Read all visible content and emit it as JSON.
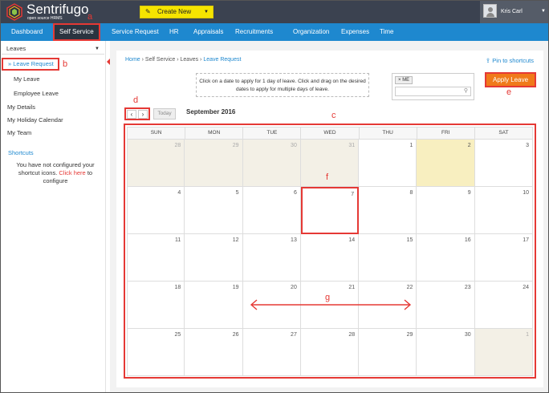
{
  "header": {
    "brand": "Sentrifugo",
    "brand_sub": "open source HRMS",
    "create_label": "Create New",
    "user_name": "Kris Carl"
  },
  "nav": {
    "items": [
      "Dashboard",
      "Self Service",
      "Service Request",
      "HR",
      "Appraisals",
      "Recruitments",
      "Organization",
      "Expenses",
      "Time"
    ]
  },
  "sidebar": {
    "select_value": "Leaves",
    "leave_request": "Leave Request",
    "my_leave": "My Leave",
    "employee_leave": "Employee Leave",
    "my_details": "My Details",
    "holiday_calendar": "My Holiday Calendar",
    "my_team": "My Team",
    "shortcuts": "Shortcuts",
    "note_pre": "You have not configured your shortcut icons.",
    "note_link": "Click here",
    "note_post": "to configure"
  },
  "main": {
    "breadcrumb": [
      "Home",
      "Self Service",
      "Leaves",
      "Leave Request"
    ],
    "pin": "Pin to shortcuts",
    "info": "Click on a date to apply for 1 day of leave. Click and drag on the desired dates to apply for multiple days of leave.",
    "chip": "ME",
    "apply": "Apply Leave",
    "today": "Today",
    "month": "September 2016"
  },
  "calendar": {
    "weekdays": [
      "SUN",
      "MON",
      "TUE",
      "WED",
      "THU",
      "FRI",
      "SAT"
    ],
    "weeks": [
      [
        "28",
        "29",
        "30",
        "31",
        "1",
        "2",
        "3"
      ],
      [
        "4",
        "5",
        "6",
        "7",
        "8",
        "9",
        "10"
      ],
      [
        "11",
        "12",
        "13",
        "14",
        "15",
        "16",
        "17"
      ],
      [
        "18",
        "19",
        "20",
        "21",
        "22",
        "23",
        "24"
      ],
      [
        "25",
        "26",
        "27",
        "28",
        "29",
        "30",
        "1"
      ]
    ]
  },
  "annotations": {
    "a": "a",
    "b": "b",
    "c": "c",
    "d": "d",
    "e": "e",
    "f": "f",
    "g": "g"
  }
}
